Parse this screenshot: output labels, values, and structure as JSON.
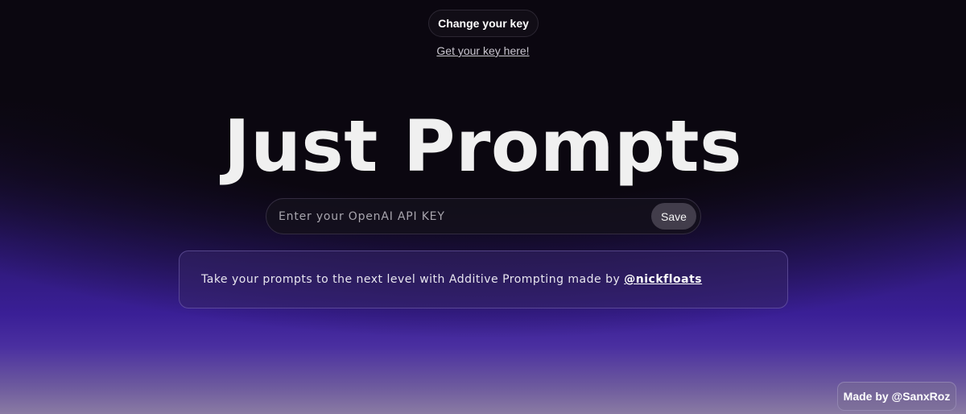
{
  "header": {
    "change_key_label": "Change your key",
    "get_key_link": "Get your key here!"
  },
  "hero": {
    "title": "Just Prompts"
  },
  "key_form": {
    "input_placeholder": "Enter your OpenAI API KEY",
    "input_value": "",
    "save_label": "Save"
  },
  "info": {
    "text": "Take your prompts to the next level with Additive Prompting made by",
    "link": "@nickfloats"
  },
  "footer": {
    "made_by": "Made by @SanxRoz"
  },
  "colors": {
    "background_top": "#0b0710",
    "background_purple": "#3a1f96",
    "text": "#f0f0f0",
    "save_button": "#423d4b"
  }
}
